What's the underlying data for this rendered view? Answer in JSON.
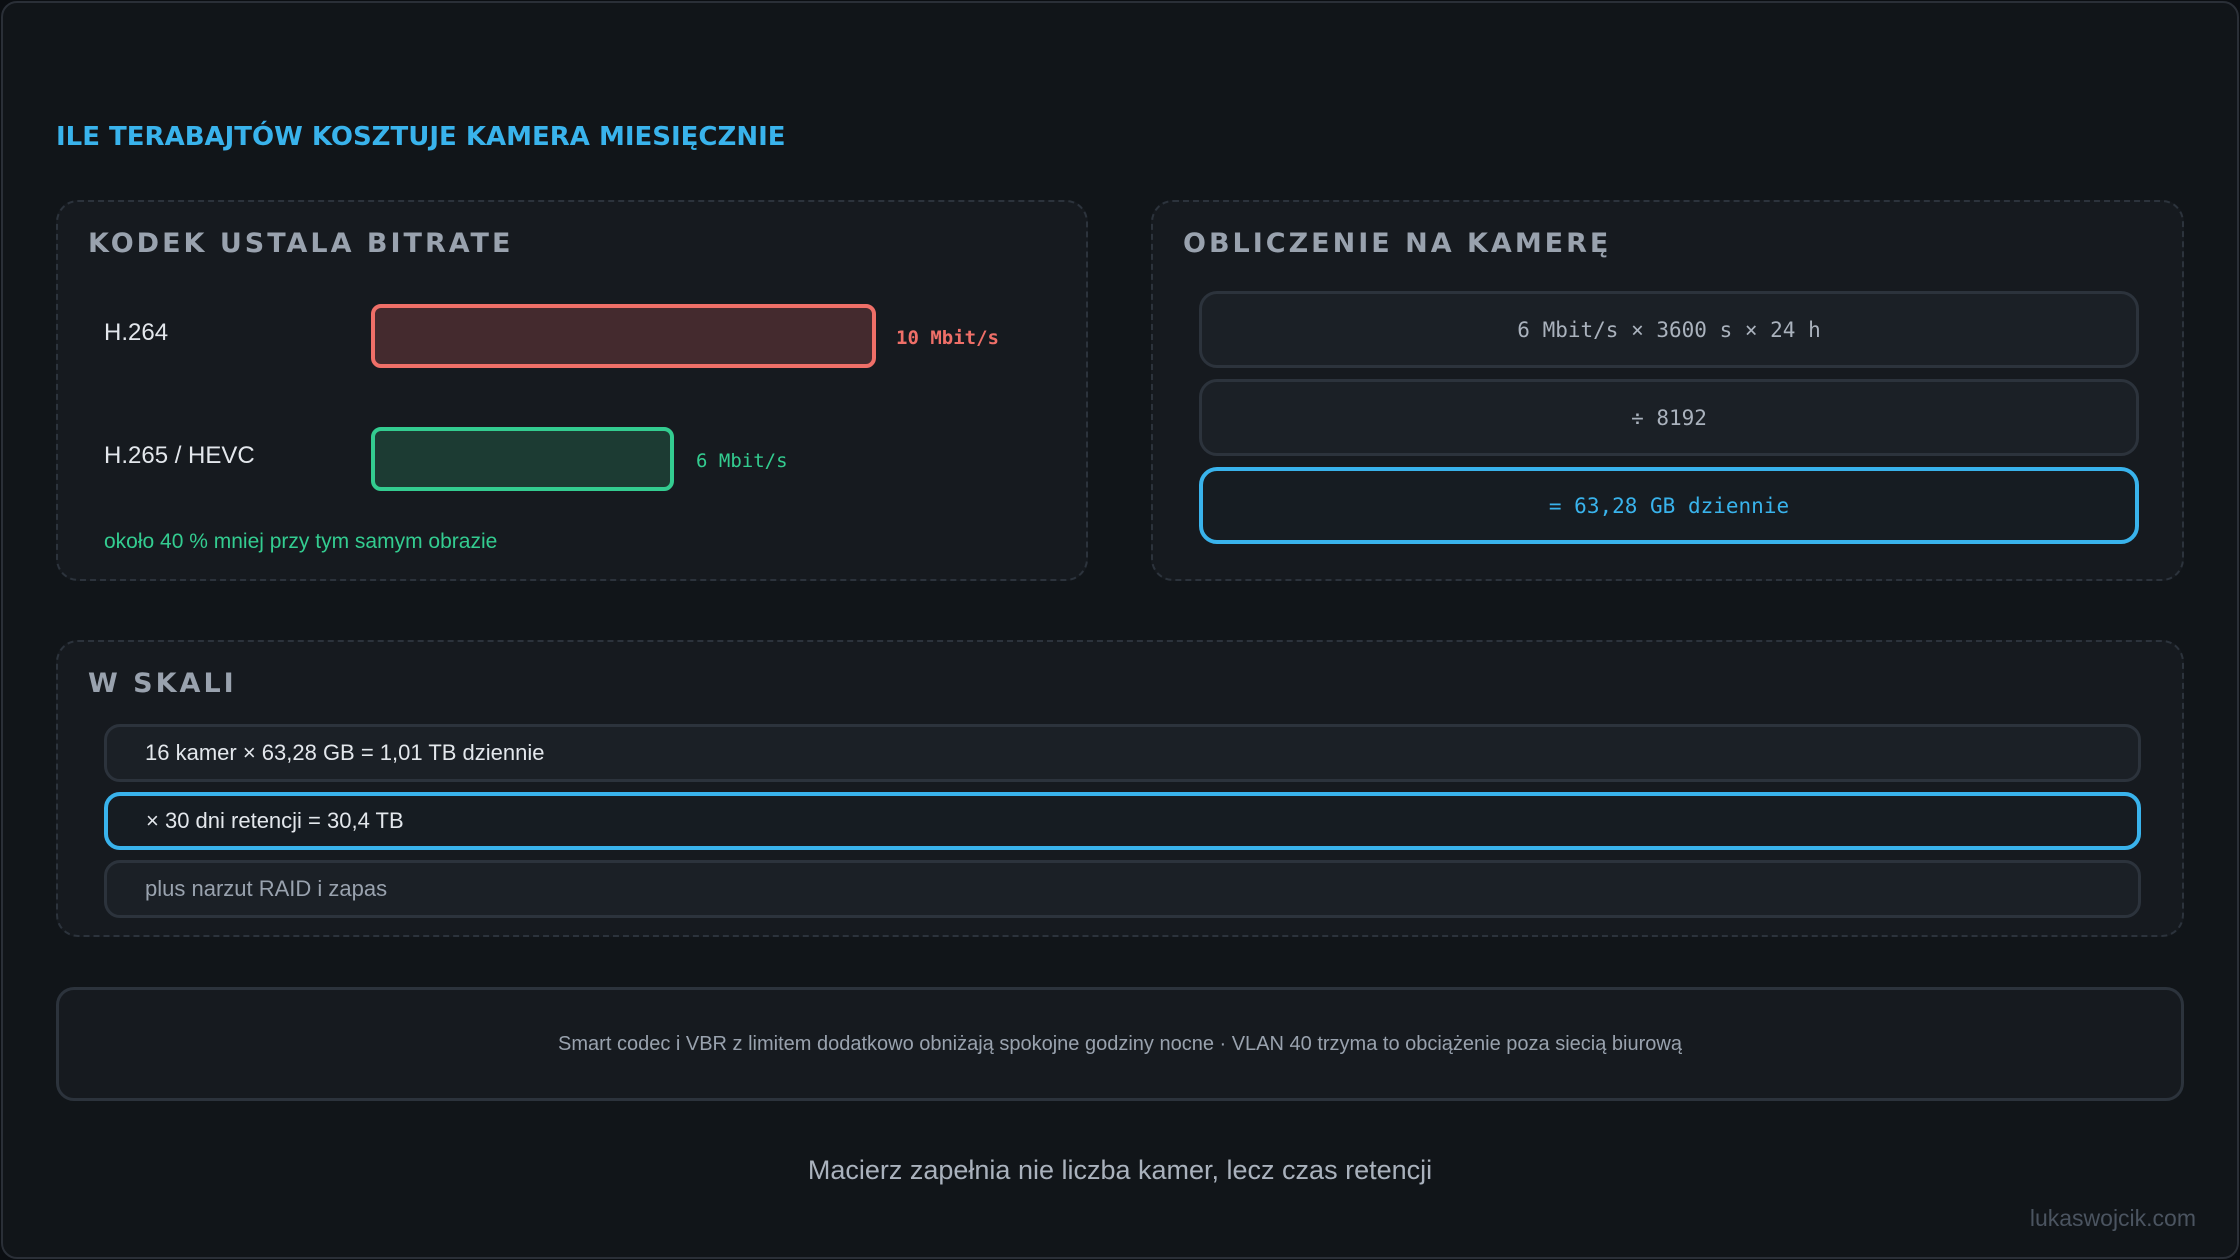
{
  "title": "ILE TERABAJTÓW KOSZTUJE KAMERA MIESIĘCZNIE",
  "codec_panel": {
    "title": "KODEK USTALA BITRATE",
    "codecs": [
      {
        "name": "H.264",
        "bitrate_label": "10 Mbit/s",
        "bitrate_mbit": 10,
        "color": "#ef6f68"
      },
      {
        "name": "H.265 / HEVC",
        "bitrate_label": "6 Mbit/s",
        "bitrate_mbit": 6,
        "color": "#33cc90"
      }
    ],
    "note": "około 40 % mniej przy tym samym obrazie"
  },
  "calc_panel": {
    "title": "OBLICZENIE NA KAMERĘ",
    "steps": [
      "6 Mbit/s × 3600 s × 24 h",
      "÷ 8192",
      "= 63,28 GB dziennie"
    ],
    "highlight_color": "#39b3ec"
  },
  "scale_panel": {
    "title": "W SKALI",
    "rows": [
      "16 kamer × 63,28 GB = 1,01 TB dziennie",
      "× 30 dni retencji = 30,4 TB",
      "plus narzut RAID i zapas"
    ]
  },
  "footnote": "Smart codec i VBR z limitem dodatkowo obniżają spokojne godziny nocne · VLAN 40 trzyma to obciążenie poza siecią biurową",
  "caption": "Macierz zapełnia nie liczba kamer, lecz czas retencji",
  "watermark": "lukaswojcik.com"
}
